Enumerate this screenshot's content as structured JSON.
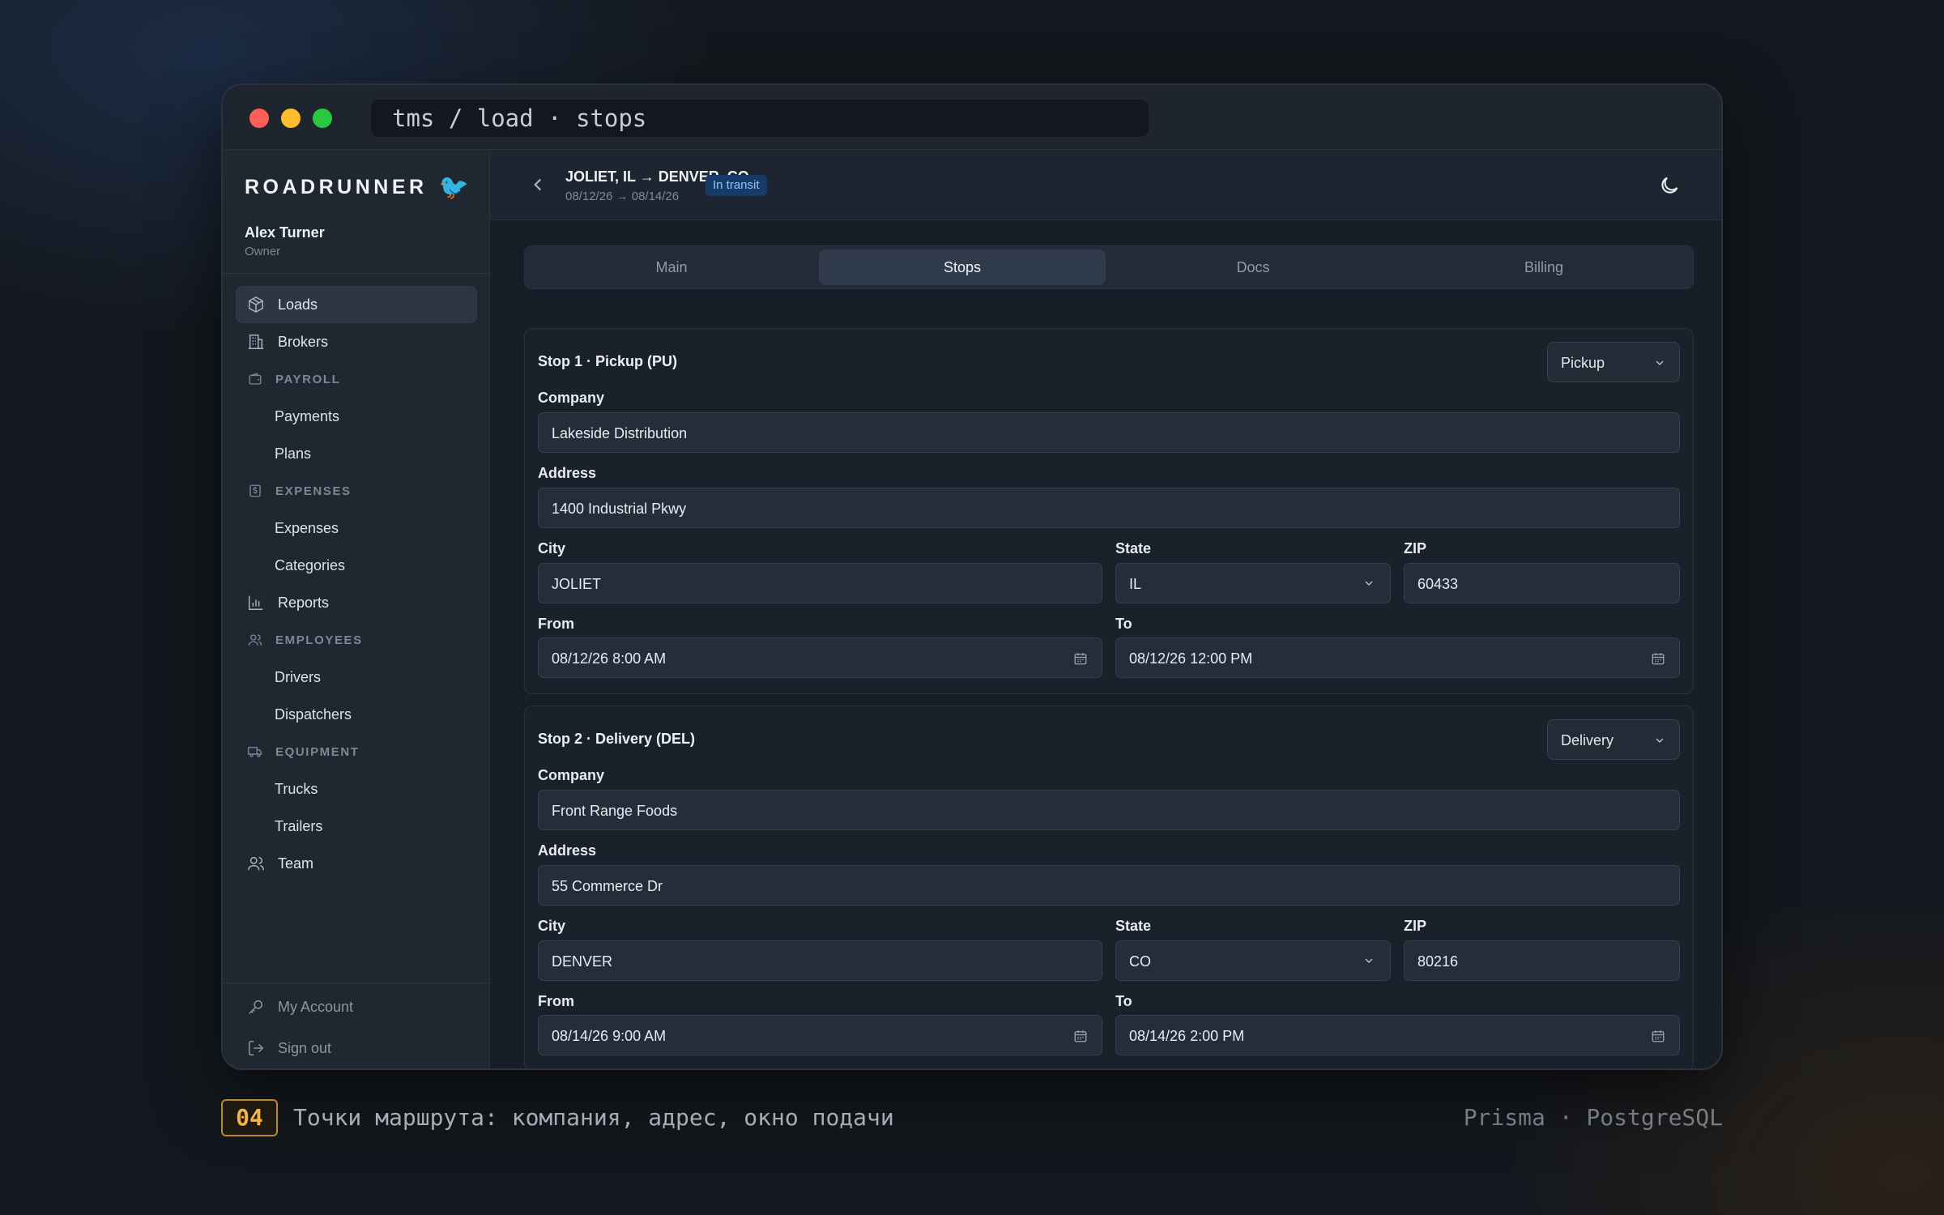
{
  "window": {
    "path": "tms / load · stops"
  },
  "sidebar": {
    "brand": "ROADRUNNER",
    "brand_icon": "🐦",
    "user": {
      "name": "Alex Turner",
      "role": "Owner"
    },
    "items": {
      "loads": "Loads",
      "brokers": "Brokers",
      "payroll": "PAYROLL",
      "payments": "Payments",
      "plans": "Plans",
      "expenses_section": "EXPENSES",
      "expenses": "Expenses",
      "categories": "Categories",
      "reports": "Reports",
      "employees": "EMPLOYEES",
      "drivers": "Drivers",
      "dispatchers": "Dispatchers",
      "equipment": "EQUIPMENT",
      "trucks": "Trucks",
      "trailers": "Trailers",
      "team": "Team"
    },
    "bottom": {
      "account": "My Account",
      "signout": "Sign out"
    }
  },
  "header": {
    "route": "JOLIET, IL → DENVER, CO",
    "dates": "08/12/26 → 08/14/26",
    "status": "In transit"
  },
  "tabs": {
    "main": "Main",
    "stops": "Stops",
    "docs": "Docs",
    "billing": "Billing"
  },
  "labels": {
    "company": "Company",
    "address": "Address",
    "city": "City",
    "state": "State",
    "zip": "ZIP",
    "from": "From",
    "to": "To"
  },
  "stops": [
    {
      "title": "Stop 1 · Pickup (PU)",
      "type": "Pickup",
      "company": "Lakeside Distribution",
      "address": "1400 Industrial Pkwy",
      "city": "JOLIET",
      "state": "IL",
      "zip": "60433",
      "from": "08/12/26 8:00 AM",
      "to": "08/12/26 12:00 PM"
    },
    {
      "title": "Stop 2 · Delivery (DEL)",
      "type": "Delivery",
      "company": "Front Range Foods",
      "address": "55 Commerce Dr",
      "city": "DENVER",
      "state": "CO",
      "zip": "80216",
      "from": "08/14/26 9:00 AM",
      "to": "08/14/26 2:00 PM"
    }
  ],
  "caption": {
    "number": "04",
    "text": "Точки маршрута: компания, адрес, окно подачи",
    "stack": "Prisma · PostgreSQL"
  }
}
